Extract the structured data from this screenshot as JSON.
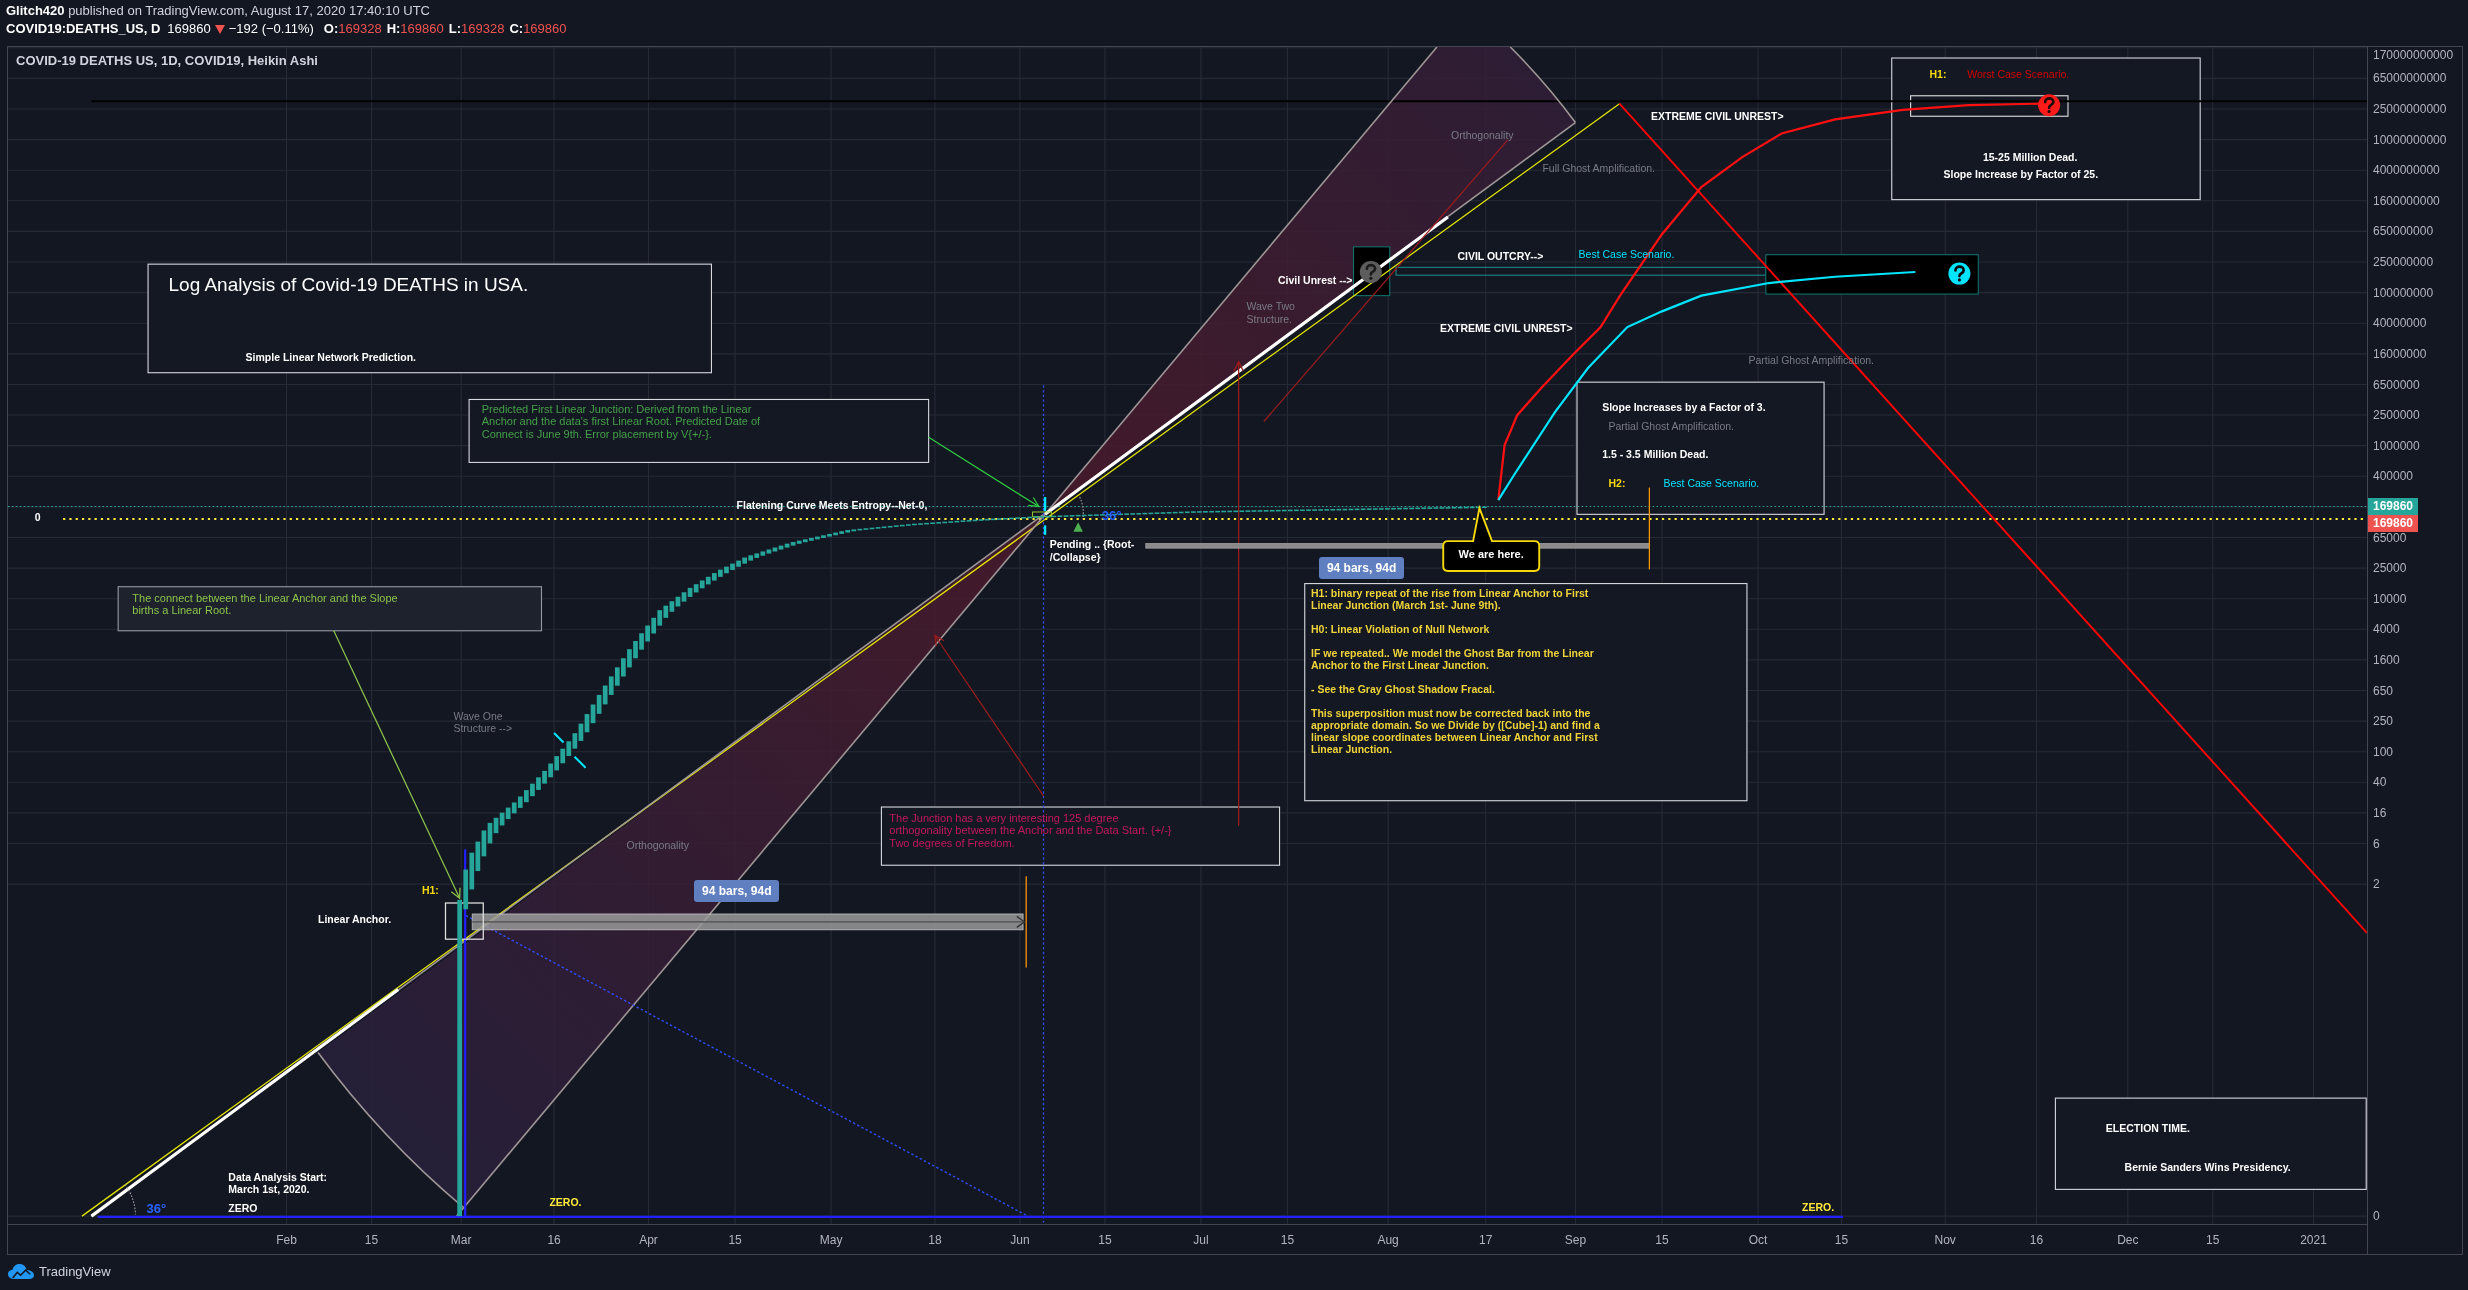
{
  "header": {
    "publish_line": "**Glitch420** published on TradingView.com, August 17, 2020 17:40:10 UTC",
    "symbol": "COVID19:DEATHS_US, D",
    "last_price": "169860",
    "price_down": true,
    "change": "−192 (−0.11%)",
    "ohlc": [
      {
        "label": "O:",
        "value": "169328"
      },
      {
        "label": "H:",
        "value": "169860"
      },
      {
        "label": "L:",
        "value": "169328"
      },
      {
        "label": "C:",
        "value": "169860"
      }
    ]
  },
  "chart": {
    "legend": "COVID-19 DEATHS US, 1D, COVID19, Heikin Ashi",
    "title_box": {
      "title": "Log Analysis of Covid-19 DEATHS in USA.",
      "subtitle": "Simple Linear Network Prediction."
    },
    "worst_case_box": {
      "tag": "H1:",
      "scenario": "Worst Case Scenario.",
      "deaths": "15-25 Million Dead.",
      "slope": "Slope Increase by Factor of 25."
    },
    "labels": [
      {
        "text": "EXTREME CIVIL UNREST>",
        "color": "#ffffff"
      },
      {
        "text": "Orthogonality",
        "color": "#787b86"
      },
      {
        "text": "Full Ghost Amplification.",
        "color": "#787b86"
      },
      {
        "text": "CIVIL OUTCRY-->",
        "color": "#ffffff"
      },
      {
        "text": "Best Case Scenario.",
        "color": "#00e5ff"
      },
      {
        "text": "Civil Unrest -->",
        "color": "#ffffff"
      },
      {
        "text": "Wave Two\nStructure.",
        "color": "#787b86"
      },
      {
        "text": "EXTREME CIVIL UNREST>",
        "color": "#ffffff"
      },
      {
        "text": "Partial Ghost Amplification.",
        "color": "#787b86"
      },
      {
        "text": "0",
        "color": "#ffffff"
      },
      {
        "text": "Flatening Curve Meets Entropy--Net-0,",
        "color": "#ffffff"
      },
      {
        "text": "36°",
        "color": "#2962ff"
      },
      {
        "text": "Pending .. {Root-\n/Collapse}",
        "color": "#ffffff"
      },
      {
        "text": "Wave One\nStructure -->",
        "color": "#787b86"
      },
      {
        "text": "Orthogonality",
        "color": "#787b86"
      },
      {
        "text": "H1:",
        "color": "#f5d90a"
      },
      {
        "text": "Linear Anchor.",
        "color": "#ffffff"
      },
      {
        "text": "Data Analysis Start:\nMarch 1st, 2020.",
        "color": "#ffffff"
      },
      {
        "text": "36°",
        "color": "#2962ff"
      },
      {
        "text": "ZERO",
        "color": "#ffffff"
      },
      {
        "text": "ZERO.",
        "color": "#ffeb3b"
      },
      {
        "text": "ZERO.",
        "color": "#ffeb3b"
      }
    ],
    "notes": [
      {
        "text": "Predicted First Linear Junction: Derived from the Linear\nAnchor and the data's first Linear Root. Predicted Date of\nConnect is June 9th. Error placement by V{+/-}.",
        "color": "#43a047"
      },
      {
        "text": "The connect between the Linear Anchor and the Slope\nbirths a Linear Root.",
        "color": "#8bc34a"
      },
      {
        "text": "The Junction has a very interesting 125 degree\northogonality between the Anchor and the Data Start. {+/-}\nTwo degrees of Freedom.",
        "color": "#c2185b"
      }
    ],
    "best_case_box": {
      "heading": "Slope Increases by a Factor of 3.",
      "note": "Partial Ghost Amplification.",
      "deaths": "1.5 - 3.5 Million Dead.",
      "tag": "H2:",
      "scenario": "Best Case Scenario."
    },
    "callout": "We are here.",
    "measure_badges": [
      "94 bars, 94d",
      "94 bars, 94d"
    ],
    "hypothesis_note": {
      "paragraphs": [
        "H1: binary repeat of the rise from Linear Anchor to First\nLinear Junction (March 1st- June 9th).",
        "H0: Linear Violation of Null Network",
        "IF we repeated.. We model the Ghost Bar from the Linear\nAnchor to the First Linear Junction.",
        "- See the Gray Ghost Shadow Fracal.",
        "This superposition must now be corrected back into the\nappropriate domain. So we Divide by ([Cube]-1) and find a\nlinear slope coordinates between Linear Anchor and First\nLinear Junction."
      ]
    },
    "election_box": {
      "title": "ELECTION TIME.",
      "text": "Bernie Sanders Wins Presidency."
    },
    "price_axis": {
      "labels": [
        "170000000000",
        "65000000000",
        "25000000000",
        "10000000000",
        "4000000000",
        "1600000000",
        "650000000",
        "250000000",
        "100000000",
        "40000000",
        "16000000",
        "6500000",
        "2500000",
        "1000000",
        "400000",
        "65000",
        "25000",
        "10000",
        "4000",
        "1600",
        "650",
        "250",
        "100",
        "40",
        "16",
        "6",
        "2"
      ],
      "badges": [
        {
          "text": "169860",
          "color": "#26a69a"
        },
        {
          "text": "169860",
          "color": "#ef5350"
        }
      ],
      "zero_label": "0"
    },
    "time_axis": {
      "labels": [
        "Feb",
        "15",
        "Mar",
        "16",
        "Apr",
        "15",
        "May",
        "18",
        "Jun",
        "15",
        "Jul",
        "15",
        "Aug",
        "17",
        "Sep",
        "15",
        "Oct",
        "15",
        "Nov",
        "16",
        "Dec",
        "15",
        "2021"
      ]
    }
  },
  "footer": {
    "brand": "TradingView"
  }
}
